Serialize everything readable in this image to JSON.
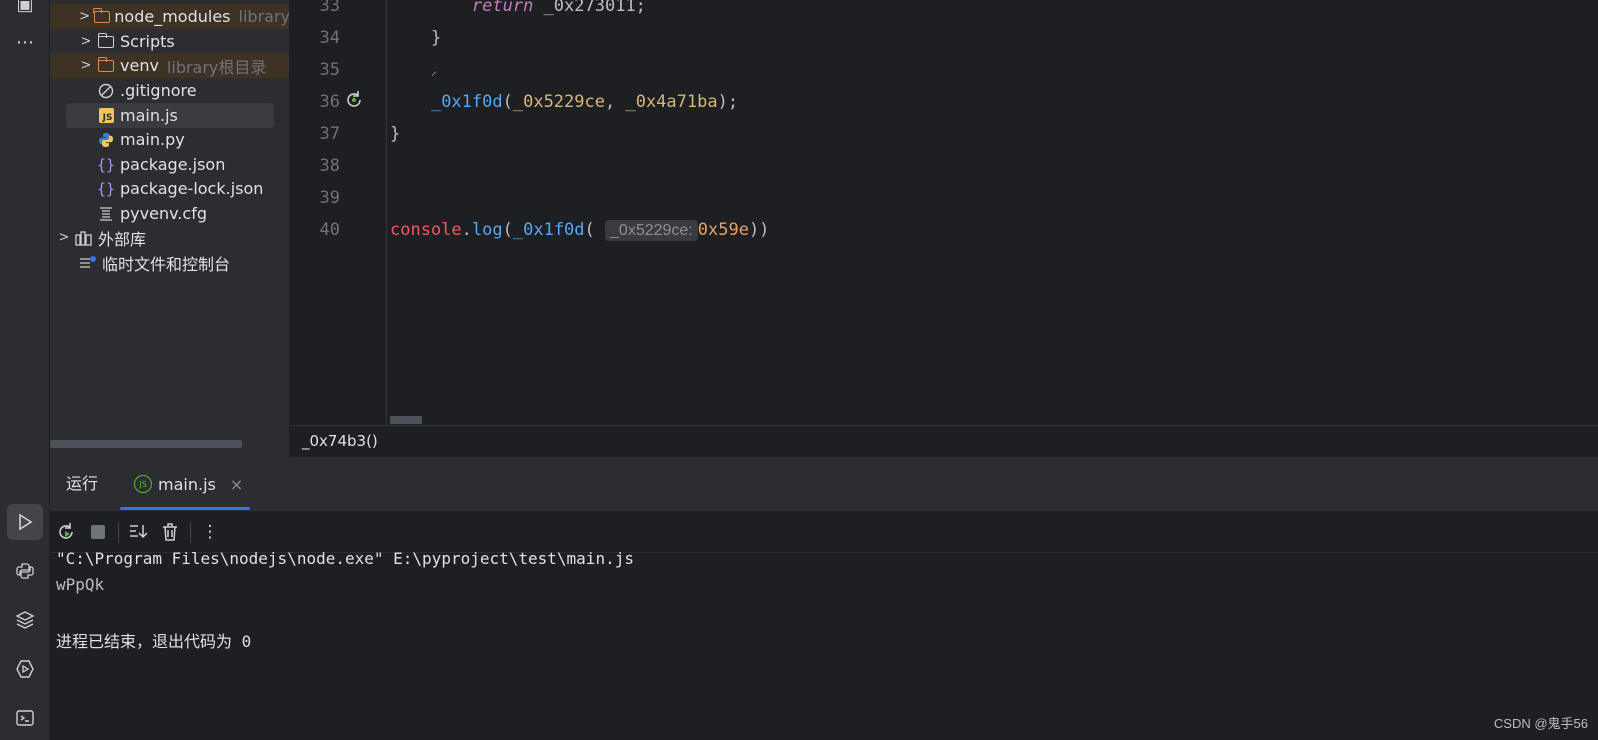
{
  "project_tree": {
    "items": [
      {
        "label": "node_modules",
        "hint": "library",
        "icon": "folder-icon"
      },
      {
        "label": "Scripts",
        "hint": "",
        "icon": "folder-icon"
      },
      {
        "label": "venv",
        "hint": "library根目录",
        "icon": "folder-icon"
      },
      {
        "label": ".gitignore",
        "hint": "",
        "icon": "ignore-file-icon"
      },
      {
        "label": "main.js",
        "hint": "",
        "icon": "js-file-icon"
      },
      {
        "label": "main.py",
        "hint": "",
        "icon": "python-file-icon"
      },
      {
        "label": "package.json",
        "hint": "",
        "icon": "json-file-icon"
      },
      {
        "label": "package-lock.json",
        "hint": "",
        "icon": "json-file-icon"
      },
      {
        "label": "pyvenv.cfg",
        "hint": "",
        "icon": "config-file-icon"
      },
      {
        "label": "外部库",
        "hint": "",
        "icon": "external-libraries-icon"
      },
      {
        "label": "临时文件和控制台",
        "hint": "",
        "icon": "scratches-icon"
      }
    ]
  },
  "editor": {
    "lines": [
      {
        "number": "33",
        "return_kw": "return",
        "return_val": " _0x273011;"
      },
      {
        "number": "34",
        "text": "}"
      },
      {
        "number": "35",
        "text": ""
      },
      {
        "number": "36",
        "call_fn": "_0x1f0d",
        "arg1": "_0x5229ce",
        "arg2": "_0x4a71ba"
      },
      {
        "number": "37",
        "text": "}"
      },
      {
        "number": "38",
        "text": ""
      },
      {
        "number": "39",
        "text": ""
      },
      {
        "number": "40",
        "obj": "console",
        "method": "log",
        "call_fn": "_0x1f0d",
        "inlay_hint": "_0x5229ce:",
        "arg": "0x59e"
      }
    ]
  },
  "breadcrumb": {
    "text": "_0x74b3()"
  },
  "run_panel": {
    "title": "运行",
    "tab_label": "main.js",
    "console_lines": [
      "\"C:\\Program Files\\nodejs\\node.exe\" E:\\pyproject\\test\\main.js",
      "wPpQk",
      "",
      "进程已结束，退出代码为 0"
    ]
  },
  "watermark": "CSDN @鬼手56",
  "colors": {
    "accent": "#3574f0",
    "keyword": "#c77dbb",
    "function": "#56a8f5",
    "number": "#e8a163"
  }
}
